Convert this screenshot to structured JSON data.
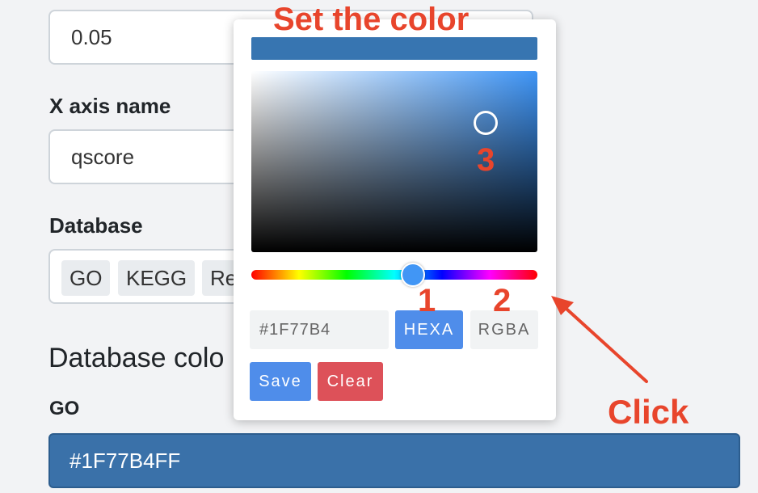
{
  "form": {
    "threshold_value": "0.05",
    "xaxis_label": "X axis name",
    "xaxis_value": "qscore",
    "database_label": "Database",
    "database_tags": [
      "GO",
      "KEGG",
      "Re"
    ],
    "section_title": "Database colo",
    "go_label": "GO",
    "go_color_value": "#1F77B4FF"
  },
  "picker": {
    "preview_color": "#3775b1",
    "hex_value": "#1F77B4",
    "hexa_label": "HEXA",
    "rgba_label": "RGBA",
    "save_label": "Save",
    "clear_label": "Clear"
  },
  "annotations": {
    "title": "Set the color",
    "step1": "1",
    "step2": "2",
    "step3": "3",
    "click": "Click",
    "color": "#e8452c"
  }
}
